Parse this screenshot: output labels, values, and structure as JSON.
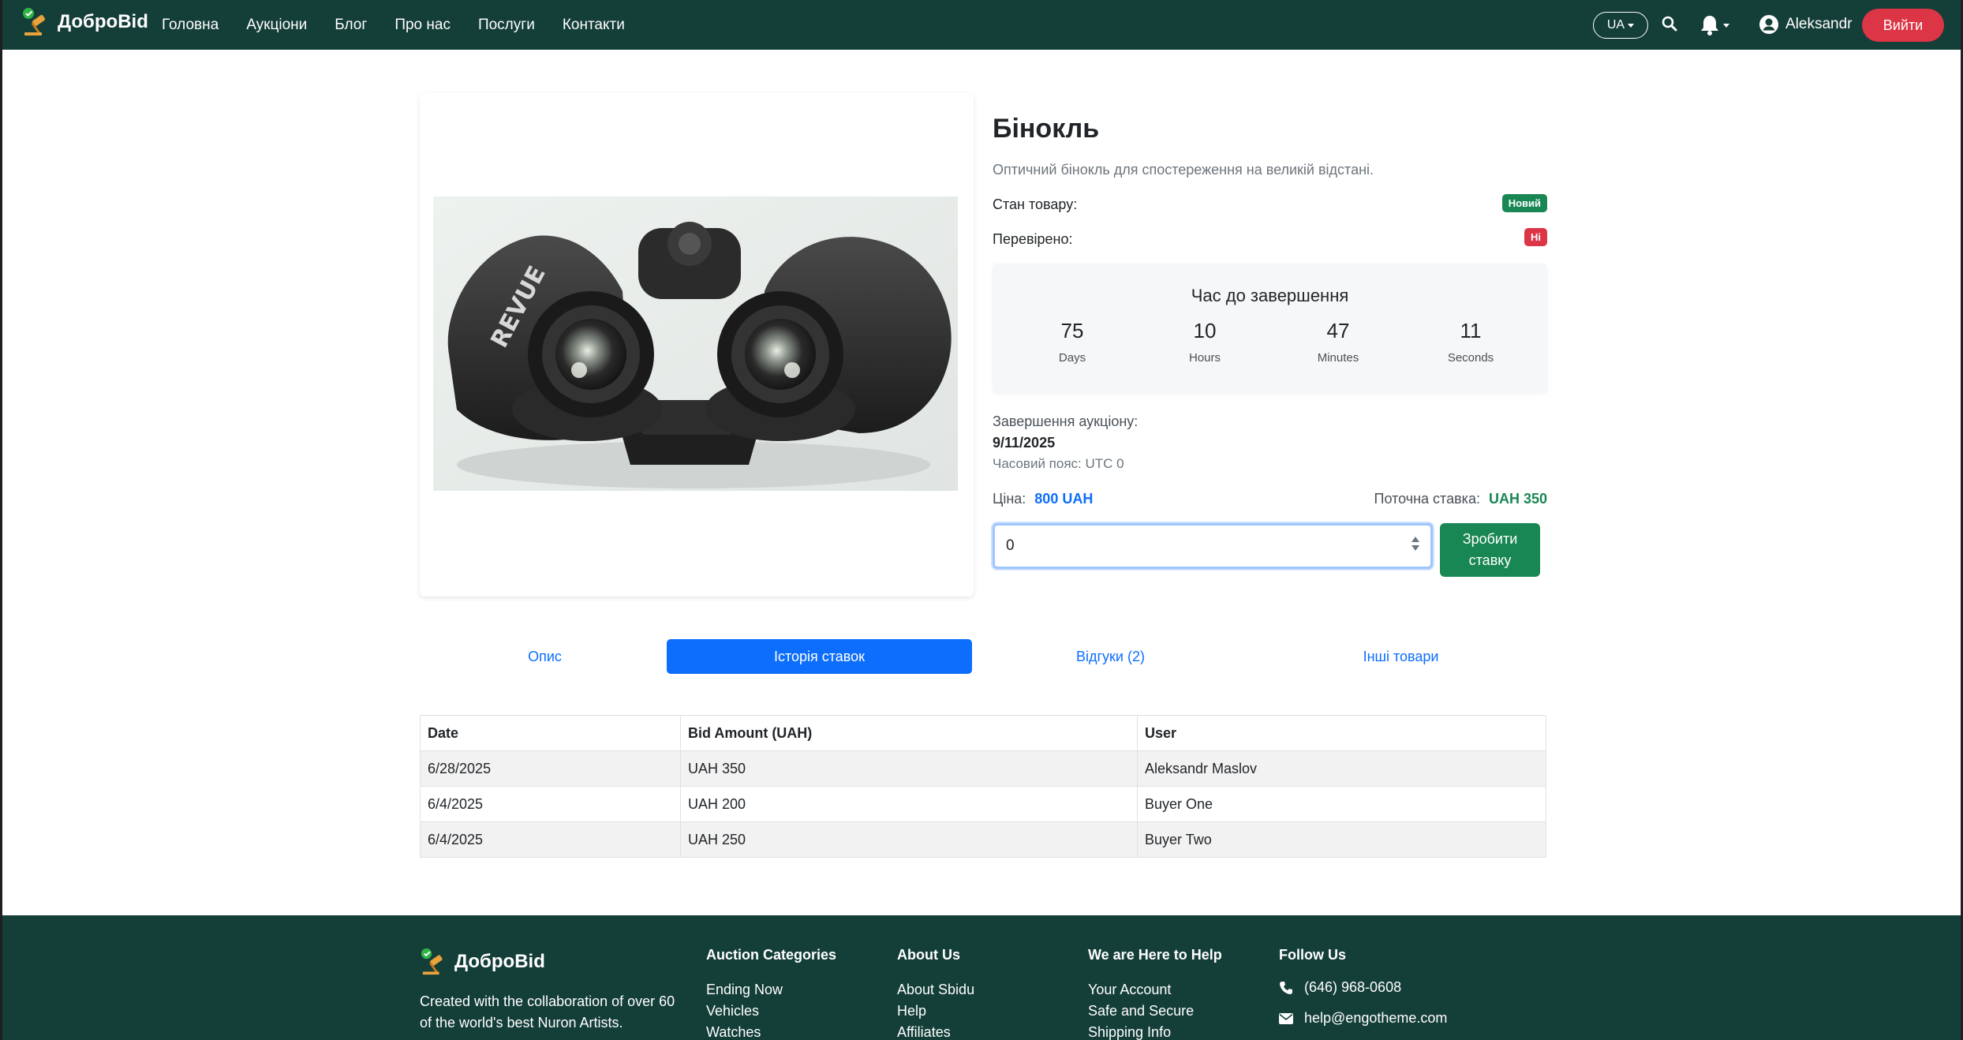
{
  "nav": {
    "brand": "ДоброBid",
    "links": [
      "Головна",
      "Аукціони",
      "Блог",
      "Про нас",
      "Послуги",
      "Контакти"
    ],
    "lang": "UA",
    "user_name": "Aleksandr",
    "logout": "Вийти"
  },
  "product": {
    "title": "Бінокль",
    "description": "Оптичний бінокль для спостереження на великій відстані.",
    "condition_label": "Стан товару:",
    "condition_badge": "Новий",
    "verified_label": "Перевірено:",
    "verified_badge": "Ні",
    "countdown": {
      "title": "Час до завершення",
      "days": "75",
      "days_label": "Days",
      "hours": "10",
      "hours_label": "Hours",
      "minutes": "47",
      "minutes_label": "Minutes",
      "seconds": "11",
      "seconds_label": "Seconds"
    },
    "end_label": "Завершення аукціону:",
    "end_date": "9/11/2025",
    "timezone": "Часовий пояс: UTC 0",
    "price_label": "Ціна:",
    "price_value": "800 UAH",
    "current_bid_label": "Поточна ставка:",
    "current_bid_value": "UAH 350",
    "bid_input_value": "0",
    "bid_button": "Зробити ставку"
  },
  "tabs": [
    {
      "label": "Опис",
      "active": false
    },
    {
      "label": "Історія ставок",
      "active": true
    },
    {
      "label": "Відгуки (2)",
      "active": false
    },
    {
      "label": "Інші товари",
      "active": false
    }
  ],
  "bid_history": {
    "headers": [
      "Date",
      "Bid Amount (UAH)",
      "User"
    ],
    "rows": [
      [
        "6/28/2025",
        "UAH 350",
        "Aleksandr Maslov"
      ],
      [
        "6/4/2025",
        "UAH 200",
        "Buyer One"
      ],
      [
        "6/4/2025",
        "UAH 250",
        "Buyer Two"
      ]
    ]
  },
  "footer": {
    "brand": "ДоброBid",
    "about_text": "Created with the collaboration of over 60 of the world's best Nuron Artists.",
    "columns": [
      {
        "title": "Auction Categories",
        "items": [
          "Ending Now",
          "Vehicles",
          "Watches"
        ]
      },
      {
        "title": "About Us",
        "items": [
          "About Sbidu",
          "Help",
          "Affiliates"
        ]
      },
      {
        "title": "We are Here to Help",
        "items": [
          "Your Account",
          "Safe and Secure",
          "Shipping Info"
        ]
      }
    ],
    "follow_title": "Follow Us",
    "phone": "(646) 968-0608",
    "email": "help@engotheme.com"
  },
  "colors": {
    "navbar_bg": "#143e38",
    "primary": "#0d6efd",
    "success": "#198754",
    "danger": "#dc3545"
  }
}
